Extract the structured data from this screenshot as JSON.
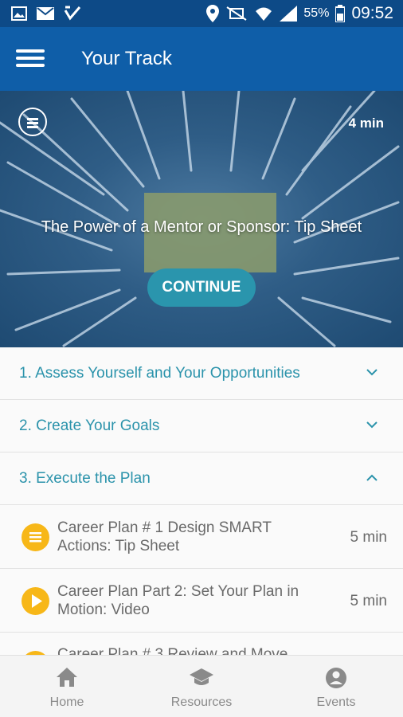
{
  "status_bar": {
    "battery_percent": "55%",
    "time": "09:52",
    "icons": [
      "gallery-icon",
      "mail-icon",
      "check-icon",
      "location-icon",
      "mute-icon",
      "wifi-icon",
      "signal-icon",
      "battery-icon"
    ]
  },
  "app_bar": {
    "title": "Your Track",
    "menu_icon": "hamburger-menu-icon"
  },
  "hero": {
    "title": "The Power of a Mentor or Sponsor: Tip Sheet",
    "duration": "4 min",
    "button_label": "CONTINUE",
    "type_icon": "document-icon"
  },
  "sections": [
    {
      "label": "1. Assess Yourself and Your Opportunities",
      "expanded": false
    },
    {
      "label": "2. Create Your Goals",
      "expanded": false
    },
    {
      "label": "3. Execute the Plan",
      "expanded": true
    }
  ],
  "items": [
    {
      "label": "Career Plan # 1 Design SMART Actions: Tip Sheet",
      "duration": "5 min",
      "icon": "document-icon"
    },
    {
      "label": "Career Plan Part 2: Set Your Plan in Motion: Video",
      "duration": "5 min",
      "icon": "play-icon"
    },
    {
      "label": "Career Plan # 3 Review and Move",
      "duration": "",
      "icon": "document-icon"
    }
  ],
  "bottom_nav": [
    {
      "label": "Home",
      "icon": "home-icon"
    },
    {
      "label": "Resources",
      "icon": "graduation-cap-icon"
    },
    {
      "label": "Events",
      "icon": "account-icon"
    }
  ],
  "colors": {
    "status_bar": "#0d4a87",
    "app_bar": "#0f5ea8",
    "accent_teal": "#2b93ab",
    "item_icon": "#f7b718"
  }
}
